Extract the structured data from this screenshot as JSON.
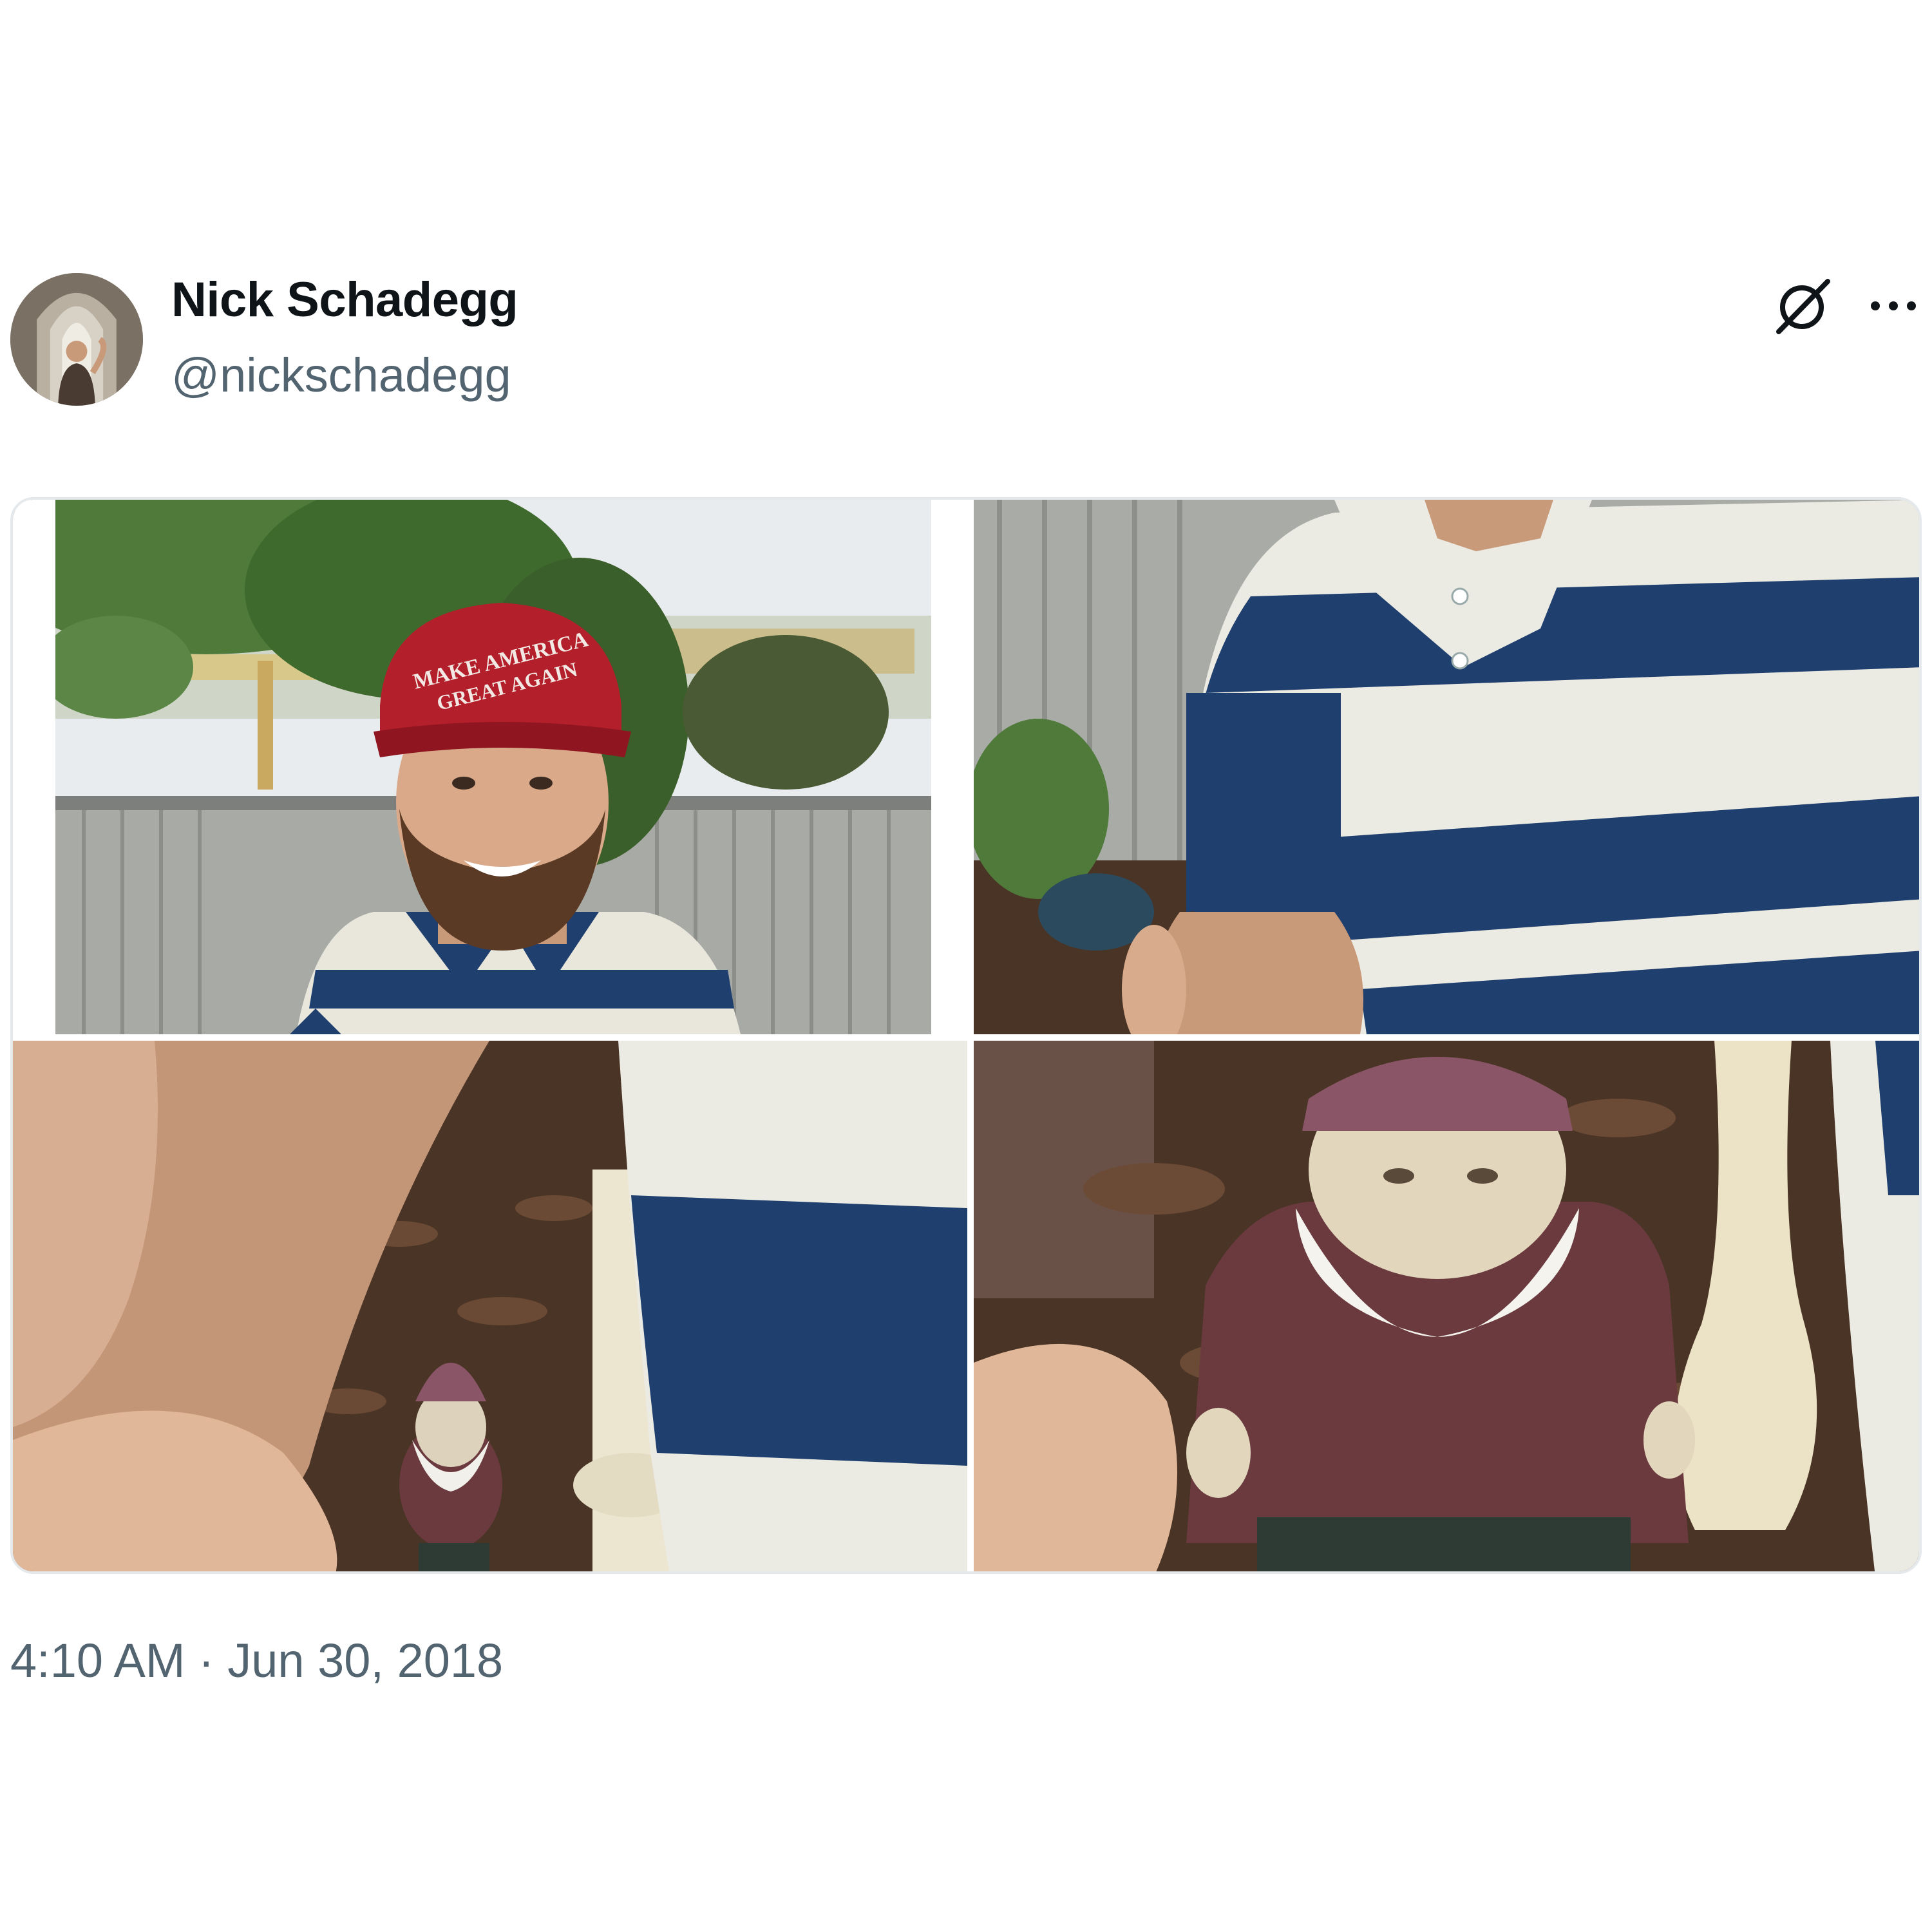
{
  "user": {
    "display_name": "Nick Schadegg",
    "handle": "@nickschadegg",
    "avatar_icon": "profile-photo"
  },
  "header_actions": {
    "grok_icon": "grok-slash-icon",
    "more_icon": "ellipsis-icon"
  },
  "media": {
    "count": 4,
    "hat_text_line1": "MAKE AMERICA",
    "hat_text_line2": "GREAT AGAIN"
  },
  "timestamp": "4:10 AM · Jun 30, 2018",
  "colors": {
    "name_text": "#0f1419",
    "secondary_text": "#536471",
    "border": "#e6e9ec"
  }
}
